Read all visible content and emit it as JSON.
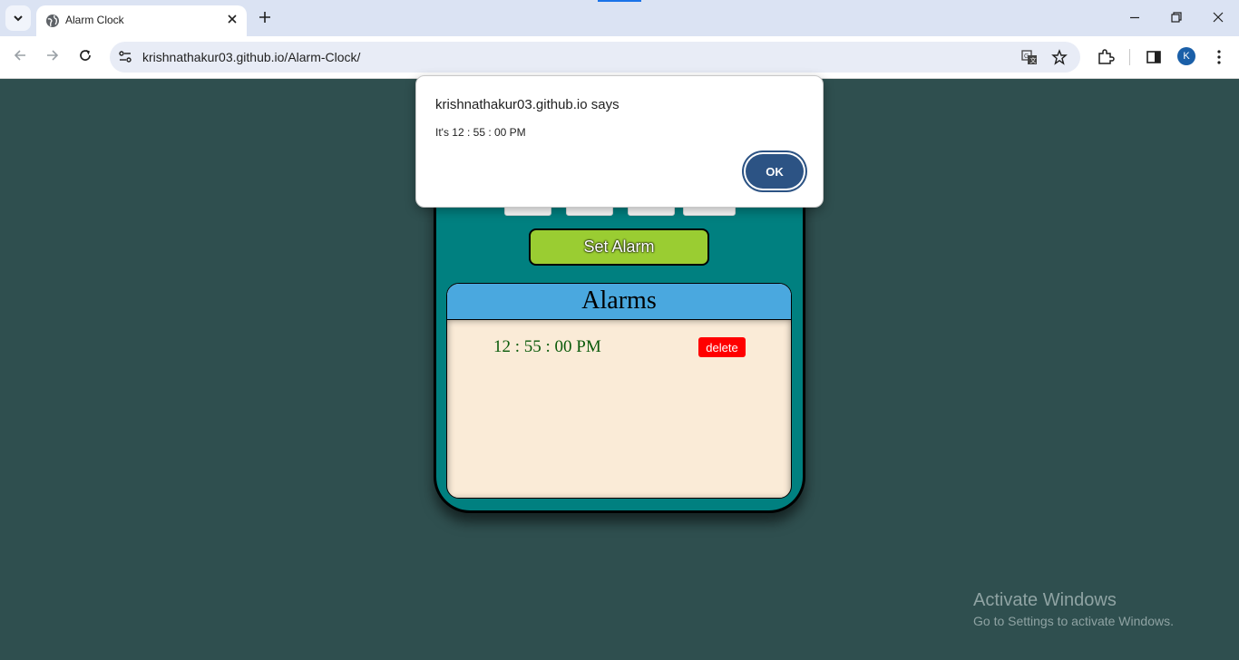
{
  "browser": {
    "tab_title": "Alarm Clock",
    "url": "krishnathakur03.github.io/Alarm-Clock/",
    "profile_initial": "K"
  },
  "dialog": {
    "title": "krishnathakur03.github.io says",
    "message": "It's 12 : 55 : 00 PM",
    "ok_label": "OK"
  },
  "app": {
    "set_alarm_label": "Set Alarm",
    "alarms_heading": "Alarms",
    "alarms": [
      {
        "time": "12 : 55 : 00 PM",
        "delete_label": "delete"
      }
    ]
  },
  "watermark": {
    "line1": "Activate Windows",
    "line2": "Go to Settings to activate Windows."
  },
  "colors": {
    "page_bg": "#2f4f4f",
    "phone_bg": "#008080",
    "set_alarm_bg": "#9acd32",
    "alarms_header_bg": "#4aa8df",
    "alarms_body_bg": "#faebd7",
    "delete_bg": "#ff0000",
    "ok_button_bg": "#2c5384"
  }
}
